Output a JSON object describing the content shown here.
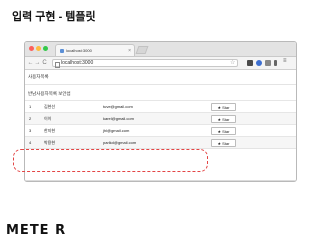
{
  "slide": {
    "title": "입력 구현 - 템플릿",
    "logo": "METE R"
  },
  "browser": {
    "tab_title": "localhost:3000",
    "tab_close": "×",
    "nav_back": "←",
    "nav_forward": "→",
    "nav_reload": "C",
    "url": "localhost:3000",
    "bookmark_icon": "☆"
  },
  "page": {
    "app_title": "사용자목록",
    "subtitle": "반남사용자목록 보안섭",
    "star_label": "Star",
    "star_glyph": "★",
    "add_label": "+",
    "users": [
      {
        "num": "1",
        "name": "김현선",
        "email": "tuve@gmail.com"
      },
      {
        "num": "2",
        "name": "이이",
        "email": "karel@gmail.com"
      },
      {
        "num": "3",
        "name": "한지현",
        "email": "jhl@gmail.com"
      },
      {
        "num": "4",
        "name": "박용현",
        "email": "parlkd@gmail.com"
      }
    ],
    "inputs": [
      {
        "placeholder": "",
        "value": ""
      },
      {
        "placeholder": "",
        "value": ""
      },
      {
        "placeholder": "",
        "value": ""
      }
    ]
  },
  "colors": {
    "highlight": "#e34545"
  }
}
